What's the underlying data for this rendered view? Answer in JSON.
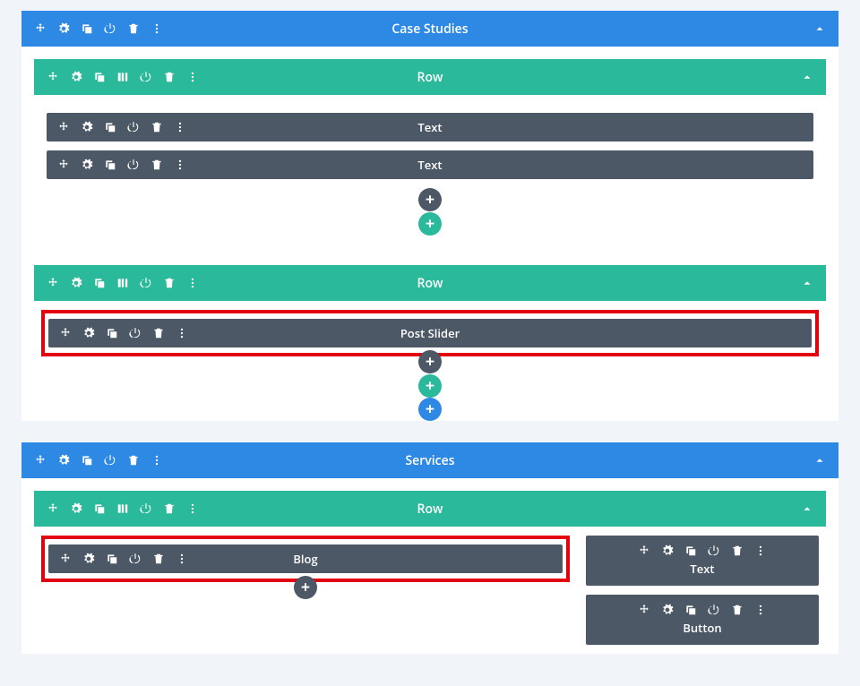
{
  "sections": [
    {
      "title": "Case Studies",
      "rows": [
        {
          "title": "Row",
          "highlight": false,
          "cols": [
            [
              {
                "title": "Text",
                "highlight": false
              },
              {
                "title": "Text",
                "highlight": false
              }
            ]
          ]
        },
        {
          "title": "Row",
          "highlight": false,
          "cols": [
            [
              {
                "title": "Post Slider",
                "highlight": true
              }
            ]
          ]
        }
      ]
    },
    {
      "title": "Services",
      "rows": [
        {
          "title": "Row",
          "highlight": false,
          "cols": [
            [
              {
                "title": "Blog",
                "highlight": true
              }
            ],
            [
              {
                "title": "Text",
                "highlight": false,
                "tall": true
              },
              {
                "title": "Button",
                "highlight": false,
                "tall": true
              }
            ]
          ]
        }
      ]
    }
  ]
}
